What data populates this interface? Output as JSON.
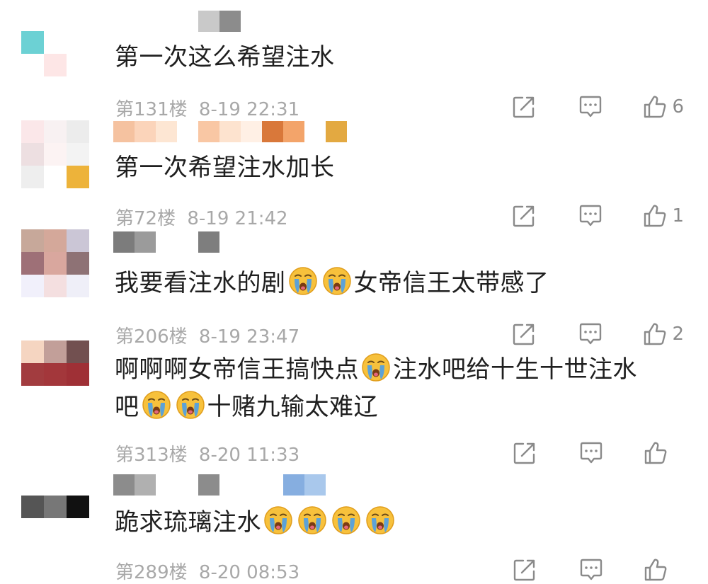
{
  "colors": {
    "text": "#1f1f1f",
    "meta": "#a8a8a8",
    "icon": "#8a8a8a"
  },
  "icons": {
    "share": "share-icon",
    "comment": "comment-icon",
    "like": "thumb-up-icon",
    "emoji": "crying-face-emoji"
  },
  "comments": [
    {
      "avatar": [
        "#ffffff",
        "#ffffff",
        "#ffffff",
        "#6cd1d4",
        "#ffffff",
        "#ffffff",
        "#ffffff",
        "#fde6e6",
        "#ffffff"
      ],
      "username": [
        "#ffffff",
        "#ffffff",
        "#ffffff",
        "#ffffff",
        "#c9c9c9",
        "#8c8c8c"
      ],
      "text": "第一次这么希望注水",
      "floor": "第131楼",
      "time": "8-19 22:31",
      "likes": "6"
    },
    {
      "avatar": [
        "#fbe7e9",
        "#f8f1f2",
        "#ececec",
        "#eddfe1",
        "#fcf3f3",
        "#f3f3f3",
        "#eeeeee",
        "#ffffff",
        "#edb33a"
      ],
      "username": [
        "#f5c2a0",
        "#fbd4ba",
        "#fde6d3",
        "#ffffff",
        "#f9c7a4",
        "#fde3cf",
        "#fff0e5",
        "#d9783a",
        "#f3a46a",
        "#ffffff",
        "#e3a941"
      ],
      "text": "第一次希望注水加长",
      "floor": "第72楼",
      "time": "8-19 21:42",
      "likes": "1"
    },
    {
      "avatar": [
        "#c7a89a",
        "#d4a89a",
        "#cbc6d6",
        "#9e7077",
        "#d9a79e",
        "#8e7275",
        "#f1f0fb",
        "#f4dfe0",
        "#efeff8"
      ],
      "username": [
        "#7c7c7c",
        "#9b9b9b",
        "#ffffff",
        "#ffffff",
        "#7e7e7e"
      ],
      "text_parts": [
        "我要看注水的剧",
        "女帝信王太带感了"
      ],
      "floor": "第206楼",
      "time": "8-19 23:47",
      "likes": "2"
    },
    {
      "avatar": [
        "#f5d5c1",
        "#c29f99",
        "#725050",
        "#a23c3f",
        "#a3373b",
        "#9f3036",
        "#ffffff",
        "#ffffff",
        "#ffffff"
      ],
      "username": [],
      "text_parts": [
        "啊啊啊女帝信王搞快点",
        "注水吧给十生十世注水",
        "吧",
        "十赌九输太难辽"
      ],
      "floor": "第313楼",
      "time": "8-20 11:33",
      "likes": ""
    },
    {
      "avatar": [
        "#ffffff",
        "#ffffff",
        "#ffffff",
        "#555555",
        "#777777",
        "#111111",
        "#ffffff",
        "#ffffff",
        "#ffffff"
      ],
      "username": [
        "#8c8c8c",
        "#b0b0b0",
        "#ffffff",
        "#ffffff",
        "#8c8c8c",
        "#ffffff",
        "#ffffff",
        "#ffffff",
        "#86aee0",
        "#a9c8ec"
      ],
      "text_parts": [
        "跪求琉璃注水"
      ],
      "floor": "第289楼",
      "time": "8-20 08:53",
      "likes": ""
    }
  ]
}
